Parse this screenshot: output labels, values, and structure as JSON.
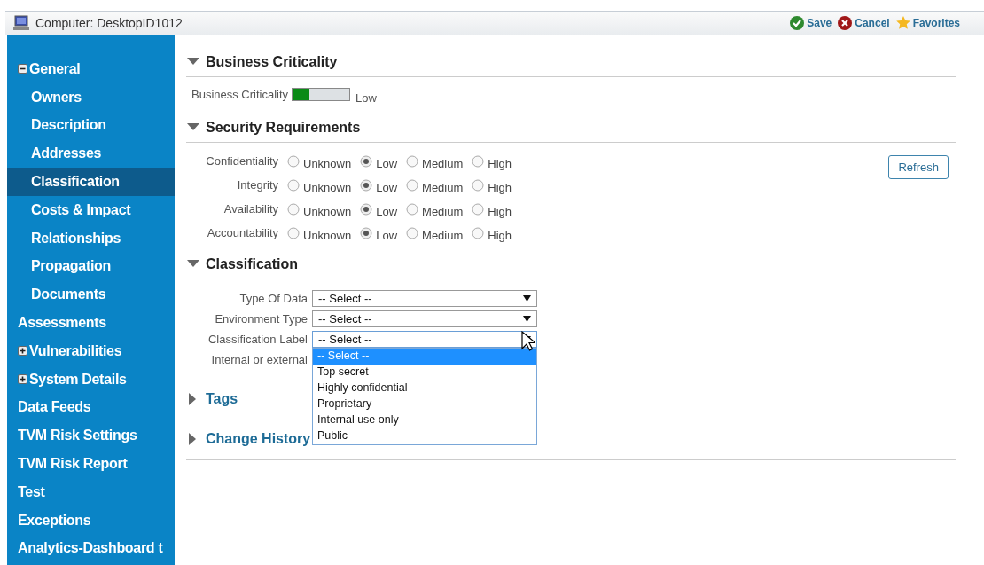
{
  "window": {
    "title": "Computer: DesktopID1012"
  },
  "toolbar": [
    {
      "kind": "save",
      "label": "Save"
    },
    {
      "kind": "cancel",
      "label": "Cancel"
    },
    {
      "kind": "favorite",
      "label": "Favorites"
    }
  ],
  "sidebar": {
    "items": [
      {
        "label": "General",
        "expanded": true,
        "selected": false,
        "children": [
          {
            "label": "Owners",
            "selected": false
          },
          {
            "label": "Description",
            "selected": false
          },
          {
            "label": "Addresses",
            "selected": false
          },
          {
            "label": "Classification",
            "selected": true
          },
          {
            "label": "Costs & Impact",
            "selected": false
          },
          {
            "label": "Relationships",
            "selected": false
          },
          {
            "label": "Propagation",
            "selected": false
          },
          {
            "label": "Documents",
            "selected": false
          }
        ]
      },
      {
        "label": "Assessments",
        "selected": false
      },
      {
        "label": "Vulnerabilities",
        "expanded": false,
        "selected": false
      },
      {
        "label": "System Details",
        "expanded": false,
        "selected": false
      },
      {
        "label": "Data Feeds",
        "selected": false
      },
      {
        "label": "TVM Risk Settings",
        "selected": false
      },
      {
        "label": "TVM Risk Report",
        "selected": false
      },
      {
        "label": "Test",
        "selected": false
      },
      {
        "label": "Exceptions",
        "selected": false
      },
      {
        "label": "Analytics-Dashboard t",
        "selected": false
      }
    ]
  },
  "sections": [
    {
      "kind": "criticality",
      "title": "Business Criticality",
      "expanded": true,
      "label": "Business Criticality",
      "level": 0.3,
      "reading": "Low"
    },
    {
      "kind": "radios",
      "title": "Security Requirements",
      "expanded": true,
      "button": "Refresh",
      "rows": [
        {
          "label": "Confidentiality",
          "options": [
            {
              "label": "Unknown",
              "selected": false
            },
            {
              "label": "Low",
              "selected": true
            },
            {
              "label": "Medium",
              "selected": false
            },
            {
              "label": "High",
              "selected": false
            }
          ]
        },
        {
          "label": "Integrity",
          "options": [
            {
              "label": "Unknown",
              "selected": false
            },
            {
              "label": "Low",
              "selected": true
            },
            {
              "label": "Medium",
              "selected": false
            },
            {
              "label": "High",
              "selected": false
            }
          ]
        },
        {
          "label": "Availability",
          "options": [
            {
              "label": "Unknown",
              "selected": false
            },
            {
              "label": "Low",
              "selected": true
            },
            {
              "label": "Medium",
              "selected": false
            },
            {
              "label": "High",
              "selected": false
            }
          ]
        },
        {
          "label": "Accountability",
          "options": [
            {
              "label": "Unknown",
              "selected": false
            },
            {
              "label": "Low",
              "selected": true
            },
            {
              "label": "Medium",
              "selected": false
            },
            {
              "label": "High",
              "selected": false
            }
          ]
        }
      ]
    },
    {
      "kind": "selects",
      "title": "Classification",
      "expanded": true,
      "fields": [
        {
          "label": "Type Of Data",
          "value": "-- Select --"
        },
        {
          "label": "Environment Type",
          "value": "-- Select --"
        },
        {
          "label": "Classification Label",
          "value": "-- Select --",
          "open": true,
          "options": [
            {
              "label": "-- Select --",
              "selected": true
            },
            {
              "label": "Top secret",
              "selected": false
            },
            {
              "label": "Highly confidential",
              "selected": false
            },
            {
              "label": "Proprietary",
              "selected": false
            },
            {
              "label": "Internal use only",
              "selected": false
            },
            {
              "label": "Public",
              "selected": false
            }
          ]
        },
        {
          "label": "Internal or external"
        }
      ]
    },
    {
      "kind": "collapsed",
      "title": "Tags",
      "expanded": false
    },
    {
      "kind": "collapsed",
      "title": "Change History",
      "expanded": false
    }
  ]
}
